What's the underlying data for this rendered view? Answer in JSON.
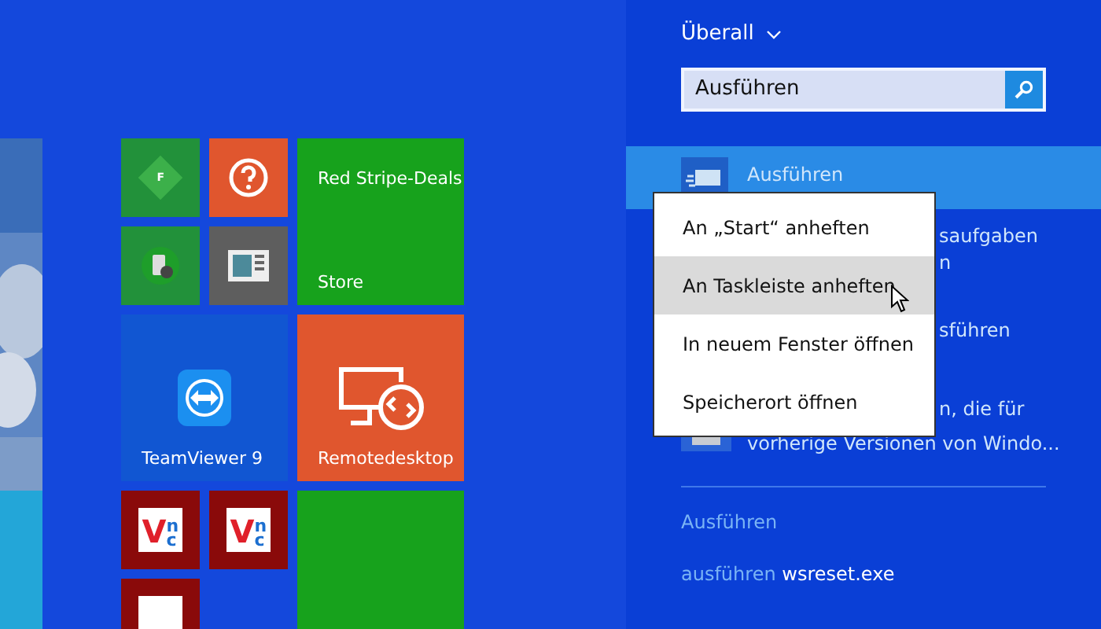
{
  "tiles": [
    {
      "kind": "diamond",
      "color": "#22913a",
      "badge": "F"
    },
    {
      "kind": "help",
      "color": "#e0562e"
    },
    {
      "kind": "store",
      "color": "#17a21c",
      "title": "Red Stripe-Deals",
      "label": "Store"
    },
    {
      "kind": "phone",
      "color": "#22913a"
    },
    {
      "kind": "news",
      "color": "#5e5e5e"
    },
    {
      "kind": "teamviewer",
      "color": "#1156d2",
      "label": "TeamViewer 9"
    },
    {
      "kind": "remote",
      "color": "#e0562e",
      "label": "Remotedesktop"
    },
    {
      "kind": "vnc",
      "color": "#8a0a0a",
      "logo": "V",
      "logo_sub": "nc"
    },
    {
      "kind": "vnc",
      "color": "#8a0a0a",
      "logo": "V",
      "logo_sub": "nc"
    },
    {
      "kind": "blank",
      "color": "#17a21c"
    },
    {
      "kind": "vnc",
      "color": "#8a0a0a"
    }
  ],
  "search_pane": {
    "scope": "Überall",
    "search": {
      "value": "Ausführen"
    },
    "results": [
      {
        "kind": "full",
        "title": "Ausführen",
        "selected": true
      },
      {
        "kind": "fragment",
        "lines": [
          "saufgaben",
          "n"
        ]
      },
      {
        "kind": "fragment",
        "lines": [
          "sführen"
        ]
      },
      {
        "kind": "mixed",
        "lines": [
          "n, die für",
          "vorherige Versionen von Windo..."
        ]
      }
    ],
    "section": "Ausführen",
    "suggestion": {
      "prefix": "ausführen",
      "term": "wsreset.exe"
    }
  },
  "context_menu": [
    {
      "label": "An „Start“ anheften",
      "selected": false
    },
    {
      "label": "An Taskleiste anheften",
      "selected": true
    },
    {
      "label": "In neuem Fenster öffnen",
      "selected": false
    },
    {
      "label": "Speicherort öffnen",
      "selected": false
    }
  ]
}
